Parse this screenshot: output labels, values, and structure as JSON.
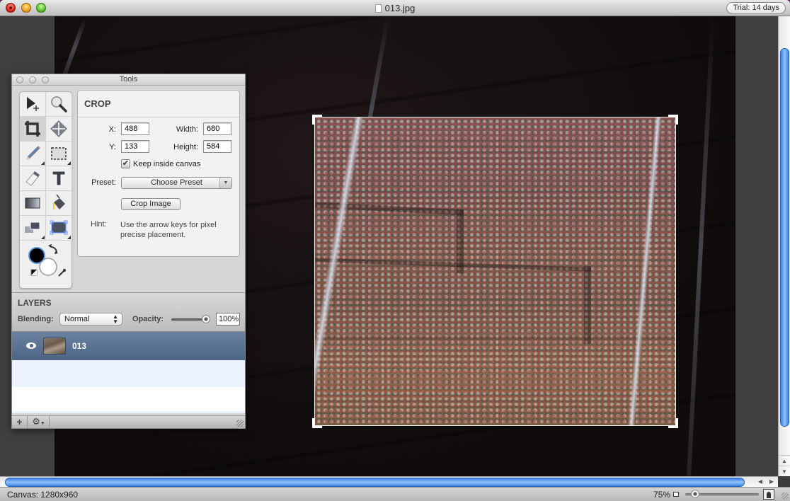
{
  "window": {
    "title": "013.jpg",
    "trial_badge": "Trial: 14 days"
  },
  "tools_palette": {
    "title": "Tools",
    "tools": [
      {
        "name": "select-tool",
        "active": false
      },
      {
        "name": "zoom-tool",
        "active": false
      },
      {
        "name": "crop-tool",
        "active": true
      },
      {
        "name": "move-tool",
        "active": false
      },
      {
        "name": "pencil-tool",
        "active": false
      },
      {
        "name": "marquee-tool",
        "active": false
      },
      {
        "name": "eraser-tool",
        "active": false
      },
      {
        "name": "text-tool",
        "active": false
      },
      {
        "name": "gradient-tool",
        "active": false
      },
      {
        "name": "fill-tool",
        "active": false
      },
      {
        "name": "clone-tool",
        "active": false
      },
      {
        "name": "transform-tool",
        "active": false
      }
    ],
    "colors": {
      "foreground": "#000000",
      "background": "#ffffff"
    }
  },
  "crop": {
    "heading": "CROP",
    "x_label": "X:",
    "x_value": "488",
    "y_label": "Y:",
    "y_value": "133",
    "width_label": "Width:",
    "width_value": "680",
    "height_label": "Height:",
    "height_value": "584",
    "keep_inside_label": "Keep inside canvas",
    "keep_inside_checked": true,
    "preset_label": "Preset:",
    "preset_value": "Choose Preset",
    "crop_button": "Crop Image",
    "hint_label": "Hint:",
    "hint_text": "Use the arrow keys for pixel precise placement."
  },
  "layers": {
    "heading": "LAYERS",
    "blending_label": "Blending:",
    "blending_value": "Normal",
    "opacity_label": "Opacity:",
    "opacity_value": "100%",
    "opacity_fraction": 1.0,
    "items": [
      {
        "name": "013",
        "visible": true,
        "selected": true
      }
    ],
    "add_symbol": "+",
    "gear_symbol": "⚙"
  },
  "status": {
    "canvas_size": "Canvas: 1280x960",
    "zoom": "75%"
  }
}
